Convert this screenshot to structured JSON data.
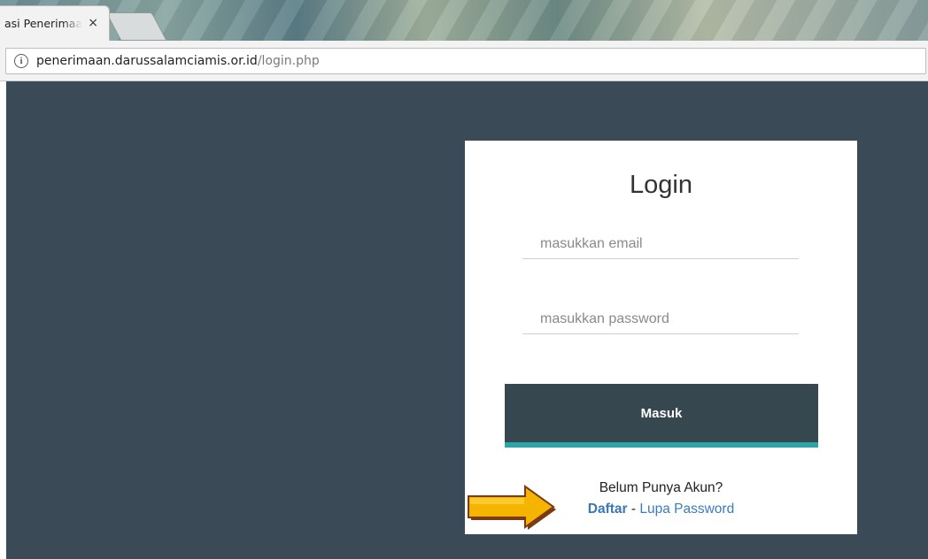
{
  "browser": {
    "tab_title": "asi Penerimaan",
    "tab_close": "×",
    "address_host": "penerimaan.darussalamciamis.or.id",
    "address_path": "/login.php",
    "info_icon": "i"
  },
  "login": {
    "title": "Login",
    "email_placeholder": "masukkan email",
    "password_placeholder": "masukkan password",
    "submit_label": "Masuk",
    "register_prompt": "Belum Punya Akun?",
    "register_link": "Daftar",
    "separator": " - ",
    "forgot_link": "Lupa Password"
  },
  "colors": {
    "page_background": "#3a4a56",
    "button_background": "#37474f",
    "button_accent": "#2fa4a7",
    "link": "#3a7cc0",
    "annotation_arrow": "#f5b400"
  },
  "annotation": {
    "icon": "arrow-right-icon"
  }
}
